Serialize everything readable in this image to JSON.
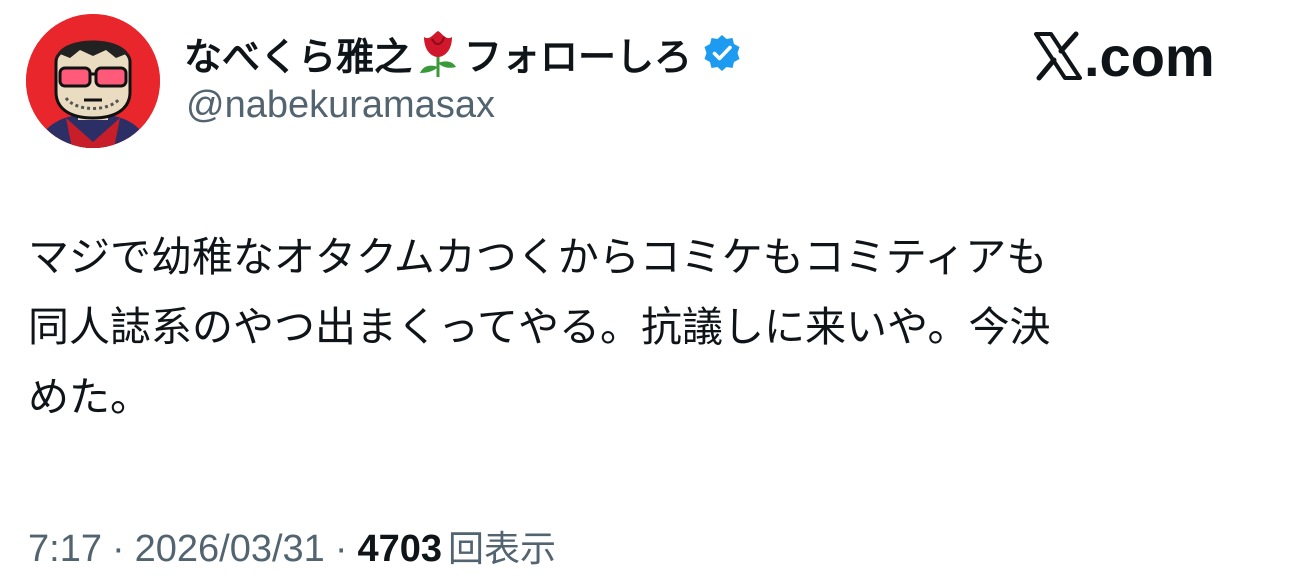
{
  "author": {
    "display_name_prefix": "なべくら雅之",
    "display_name_suffix": "フォローしろ",
    "handle": "@nabekuramasax",
    "verified": true,
    "avatar_icon": "cartoon-face-avatar",
    "emoji_icon": "rose-emoji"
  },
  "brand": {
    "logo_text": ".com",
    "logo_icon": "x-logo-icon"
  },
  "tweet": {
    "lines": [
      "マジで幼稚なオタクムカつくからコミケもコミティアも",
      "同人誌系のやつ出まくってやる。抗議しに来いや。今決",
      "めた。"
    ]
  },
  "meta": {
    "time": "7:17",
    "separator": "·",
    "date": "2026/03/31",
    "views_count": "4703",
    "views_label": "回表示"
  },
  "colors": {
    "text_primary": "#0f1419",
    "text_secondary": "#536471",
    "verified_blue": "#1d9bf0",
    "avatar_red": "#e8262b"
  }
}
